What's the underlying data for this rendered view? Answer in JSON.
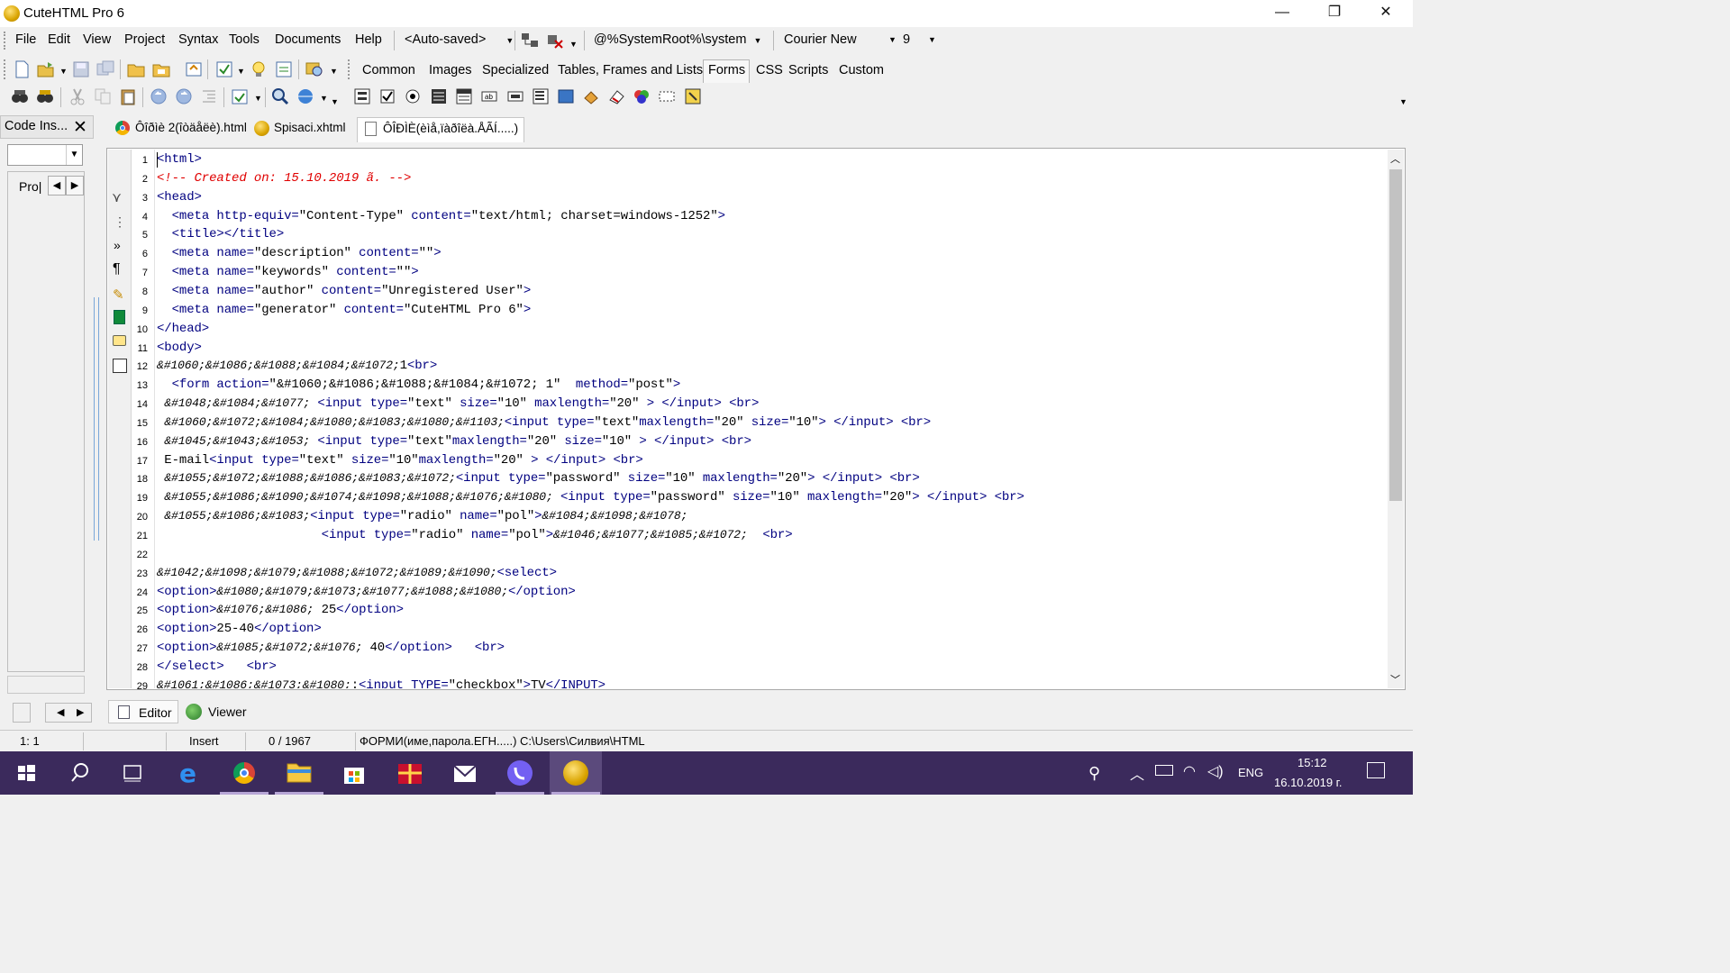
{
  "window": {
    "title": "CuteHTML Pro 6",
    "controls": {
      "minimize": "—",
      "restore": "❐",
      "close": "✕"
    }
  },
  "menubar": {
    "items": [
      {
        "label": "File"
      },
      {
        "label": "Edit"
      },
      {
        "label": "View"
      },
      {
        "label": "Project"
      },
      {
        "label": "Syntax"
      },
      {
        "label": "Tools"
      },
      {
        "label": "Documents"
      },
      {
        "label": "Help"
      }
    ],
    "autosave": "<Auto-saved>",
    "charset": "@%SystemRoot%\\system",
    "font": "Courier New",
    "font_size": "9"
  },
  "insert_tabs": [
    "Common",
    "Images",
    "Specialized",
    "Tables, Frames and Lists",
    "Forms",
    "CSS",
    "Scripts",
    "Custom"
  ],
  "active_insert_tab": "Forms",
  "left_panel": {
    "title": "Code Ins...",
    "pro_label": "Pro|",
    "close": "✕"
  },
  "doc_tabs": [
    {
      "label": "Ôîðìè 2(îòäåëè).html",
      "icon": "chrome-icon"
    },
    {
      "label": "Spisaci.xhtml",
      "icon": "cutehtml-icon"
    },
    {
      "label": "ÔÎÐÌÈ(èìå,ïàðîëà.ÅÃÍ.....)",
      "icon": "document-icon"
    }
  ],
  "code_lines": [
    "<html>",
    "<!-- Created on: 15.10.2019 ã. -->",
    "<head>",
    "  <meta http-equiv=\"Content-Type\" content=\"text/html; charset=windows-1252\">",
    "  <title></title>",
    "  <meta name=\"description\" content=\"\">",
    "  <meta name=\"keywords\" content=\"\">",
    "  <meta name=\"author\" content=\"Unregistered User\">",
    "  <meta name=\"generator\" content=\"CuteHTML Pro 6\">",
    "</head>",
    "<body>",
    "&#1060;&#1086;&#1088;&#1084;&#1072;1<br>",
    "  <form action=\"&#1060;&#1086;&#1088;&#1084;&#1072; 1\"  method=\"post\">",
    " &#1048;&#1084;&#1077; <input type=\"text\" size=\"10\" maxlength=\"20\" > </input> <br>",
    " &#1060;&#1072;&#1084;&#1080;&#1083;&#1080;&#1103;<input type=\"text\"maxlength=\"20\" size=\"10\"> </input> <br>",
    " &#1045;&#1043;&#1053; <input type=\"text\"maxlength=\"20\" size=\"10\" > </input> <br>",
    " E-mail<input type=\"text\" size=\"10\"maxlength=\"20\" > </input> <br>",
    " &#1055;&#1072;&#1088;&#1086;&#1083;&#1072;<input type=\"password\" size=\"10\" maxlength=\"20\"> </input> <br>",
    " &#1055;&#1086;&#1090;&#1074;&#1098;&#1088;&#1076;&#1080; <input type=\"password\" size=\"10\" maxlength=\"20\"> </input> <br>",
    " &#1055;&#1086;&#1083;<input type=\"radio\" name=\"pol\">&#1084;&#1098;&#1078;",
    "                      <input type=\"radio\" name=\"pol\">&#1046;&#1077;&#1085;&#1072;  <br>",
    "",
    "&#1042;&#1098;&#1079;&#1088;&#1072;&#1089;&#1090;<select>",
    "<option>&#1080;&#1079;&#1073;&#1077;&#1088;&#1080;</option>",
    "<option>&#1076;&#1086; 25</option>",
    "<option>25-40</option>",
    "<option>&#1085;&#1072;&#1076; 40</option>   <br>",
    "</select>   <br>",
    "&#1061;&#1086;&#1073;&#1080;:<input TYPE=\"checkbox\">TV</INPUT>"
  ],
  "bottom_tabs": {
    "editor": "Editor",
    "viewer": "Viewer"
  },
  "status": {
    "position": "1:   1",
    "mode": "Insert",
    "offset": "0 /    1967",
    "file": "ФОРМИ(име,парола.ЕГН.....)  C:\\Users\\Силвия\\HTML"
  },
  "taskbar": {
    "lang": "ENG",
    "time": "15:12",
    "date": "16.10.2019 г."
  },
  "colors": {
    "tag": "#000080",
    "comment": "#e00000",
    "taskbar": "#3b2a5c"
  }
}
